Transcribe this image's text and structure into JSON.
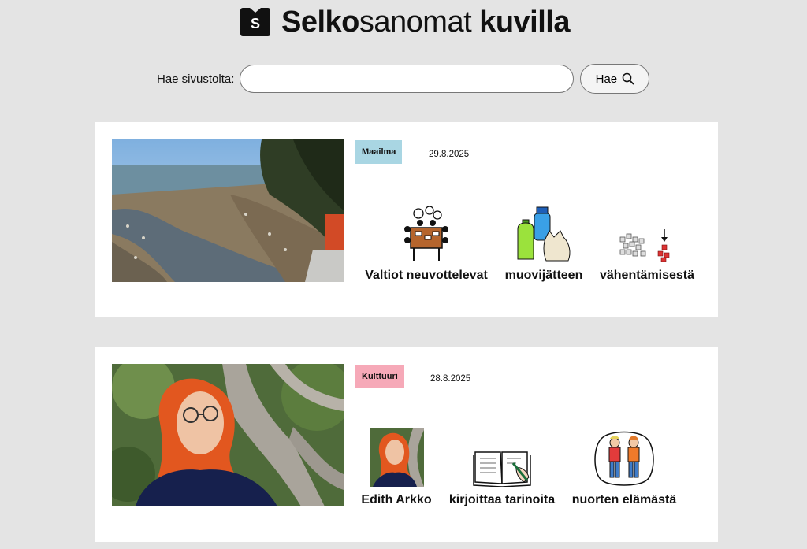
{
  "site": {
    "logo_letter": "S",
    "name_bold": "Selko",
    "name_regular": "sanomat",
    "name_suffix": "kuvilla"
  },
  "search": {
    "label": "Hae sivustolta:",
    "value": "",
    "placeholder": "",
    "button_label": "Hae"
  },
  "articles": [
    {
      "category": "Maailma",
      "category_color": "#a9d6e3",
      "date": "29.8.2025",
      "words": [
        "Valtiot neuvottelevat",
        "muovijätteen",
        "vähentämisestä"
      ]
    },
    {
      "category": "Kulttuuri",
      "category_color": "#f6a9b8",
      "date": "28.8.2025",
      "words": [
        "Edith Arkko",
        "kirjoittaa tarinoita",
        "nuorten elämästä"
      ]
    }
  ]
}
